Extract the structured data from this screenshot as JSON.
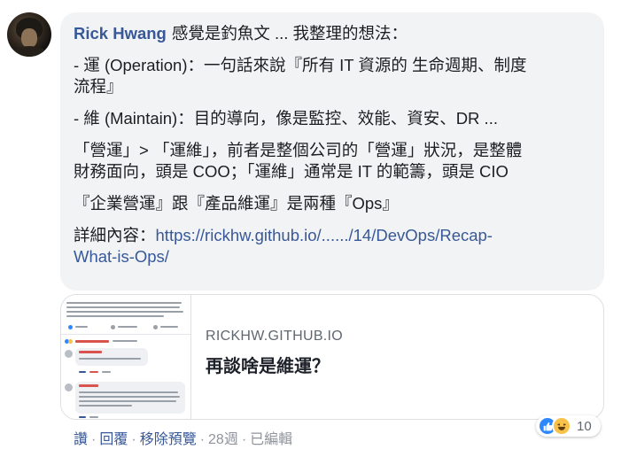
{
  "comment": {
    "author": "Rick Hwang",
    "intro": "感覺是釣魚文 ... 我整理的想法：",
    "lines": [
      "- 運 (Operation)：一句話來說『所有 IT 資源的 生命週期、制度",
      "流程』",
      "- 維 (Maintain)：目的導向，像是監控、效能、資安、DR ...",
      "「營運」> 「運維」，前者是整個公司的「營運」狀況，是整體",
      "財務面向，頭是 COO；「運維」通常是 IT 的範籌，頭是 CIO",
      "『企業營運』跟『產品維運』是兩種『Ops』"
    ],
    "detail_label": "詳細內容：",
    "link_part1": "https://rickhw.github.io/....../14/DevOps/Recap-",
    "link_part2": "What-is-Ops/"
  },
  "preview": {
    "domain": "RICKHW.GITHUB.IO",
    "title": "再談啥是維運？"
  },
  "reactions": {
    "icons": [
      "like-icon",
      "haha-icon"
    ],
    "count": "10",
    "like_color": "#2d88ff",
    "haha_color": "#f7c14a"
  },
  "actions": {
    "like": "讚",
    "reply": "回覆",
    "remove_preview": "移除預覽",
    "time": "28週",
    "edited": "已編輯",
    "separator": "·"
  },
  "colors": {
    "link": "#385898",
    "bubble": "#f2f3f5",
    "meta": "#90949c"
  }
}
